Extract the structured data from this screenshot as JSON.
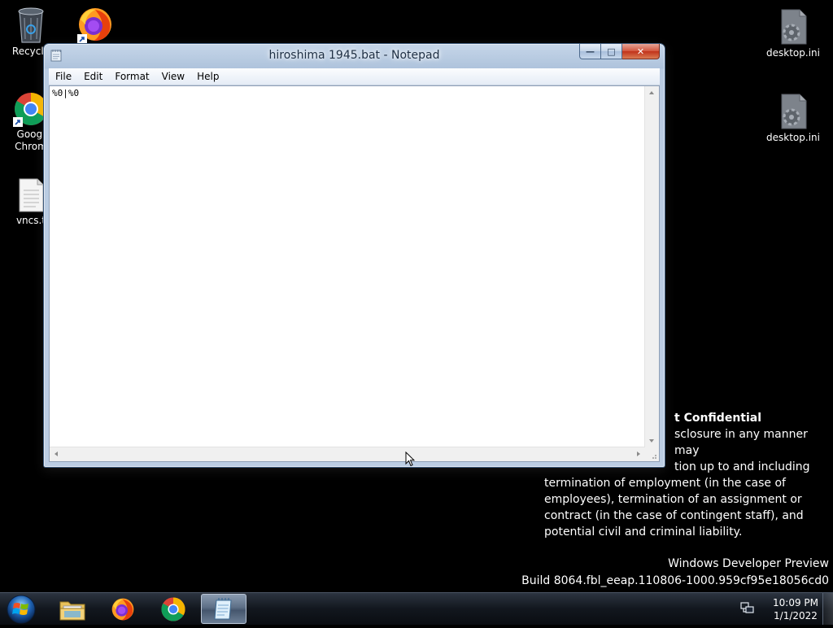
{
  "desktop": {
    "icons_left": [
      {
        "name": "recycle-bin",
        "label": "Recycle"
      },
      {
        "name": "firefox",
        "label": ""
      },
      {
        "name": "google-chrome",
        "label": "Googl\nChrom"
      },
      {
        "name": "vncs-txt",
        "label": "vncs.t"
      }
    ],
    "icons_right": [
      {
        "name": "desktop-ini-1",
        "label": "desktop.ini"
      },
      {
        "name": "desktop-ini-2",
        "label": "desktop.ini"
      }
    ],
    "recycle_label": "Recycle",
    "chrome_label_line1": "Googl",
    "chrome_label_line2": "Chrom",
    "vncs_label": "vncs.t",
    "desktop_ini_1_label": "desktop.ini",
    "desktop_ini_2_label": "desktop.ini"
  },
  "notepad": {
    "title": "hiroshima 1945.bat - Notepad",
    "menu": [
      "File",
      "Edit",
      "Format",
      "View",
      "Help"
    ],
    "menu_file": "File",
    "menu_edit": "Edit",
    "menu_format": "Format",
    "menu_view": "View",
    "menu_help": "Help",
    "content": "%0|%0",
    "minimize_glyph": "—",
    "maximize_glyph": "□",
    "close_glyph": "✕"
  },
  "watermark": {
    "heading": "t Confidential",
    "line1": "sclosure in any manner may",
    "line2": "tion up to and including",
    "line3": "termination of employment (in the case of",
    "line4": "employees), termination of an assignment or",
    "line5": "contract (in the case of contingent staff), and",
    "line6": "potential civil and criminal liability."
  },
  "build": {
    "line1": "Windows Developer Preview",
    "line2": "Build 8064.fbl_eeap.110806-1000.959cf95e18056cd0"
  },
  "taskbar": {
    "pinned": [
      "windows-explorer",
      "firefox",
      "google-chrome",
      "notepad"
    ],
    "time": "10:09 PM",
    "date": "1/1/2022"
  },
  "colors": {
    "desktop_bg": "#000000",
    "window_frame": "#b9cbe2",
    "close_button": "#c1321a",
    "taskbar": "#12171e"
  }
}
